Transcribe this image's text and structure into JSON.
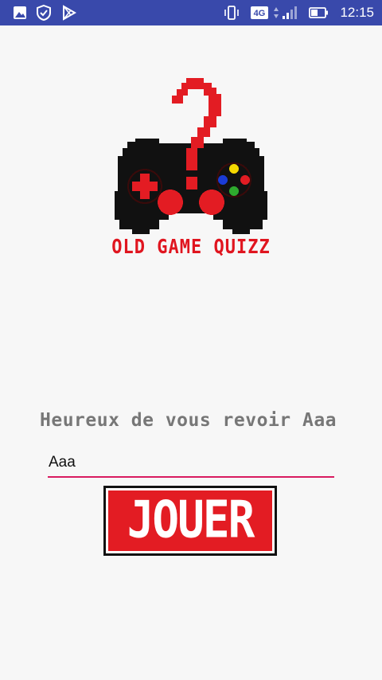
{
  "status_bar": {
    "time": "12:15",
    "network": "4G",
    "icons": [
      "image-icon",
      "shield-check-icon",
      "play-store-icon",
      "vibrate-icon",
      "network-4g-icon",
      "signal-icon",
      "battery-icon"
    ],
    "background": "#3949ab"
  },
  "logo": {
    "icon": "gamepad-question-icon",
    "title": "OLD GAME QUIZZ",
    "color": "#e0151f"
  },
  "welcome": {
    "message": "Heureux de vous revoir Aaa"
  },
  "name_field": {
    "value": "Aaa",
    "underline_color": "#d81b60"
  },
  "play_button": {
    "label": "JOUER",
    "color": "#e31c23"
  }
}
